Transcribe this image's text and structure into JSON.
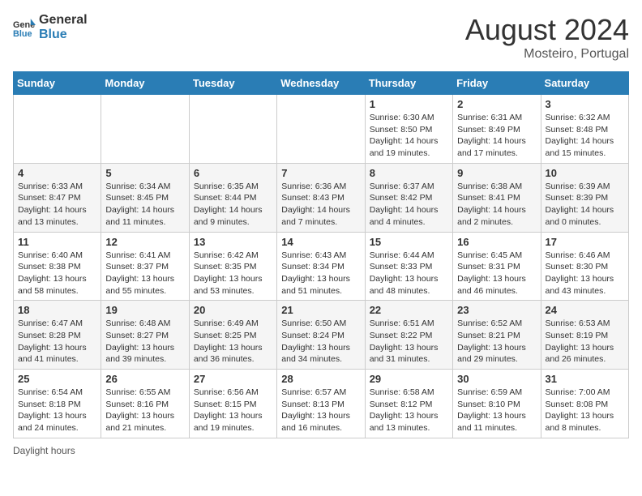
{
  "logo": {
    "line1": "General",
    "line2": "Blue"
  },
  "title": {
    "month_year": "August 2024",
    "location": "Mosteiro, Portugal"
  },
  "days_of_week": [
    "Sunday",
    "Monday",
    "Tuesday",
    "Wednesday",
    "Thursday",
    "Friday",
    "Saturday"
  ],
  "weeks": [
    [
      {
        "day": "",
        "info": ""
      },
      {
        "day": "",
        "info": ""
      },
      {
        "day": "",
        "info": ""
      },
      {
        "day": "",
        "info": ""
      },
      {
        "day": "1",
        "info": "Sunrise: 6:30 AM\nSunset: 8:50 PM\nDaylight: 14 hours\nand 19 minutes."
      },
      {
        "day": "2",
        "info": "Sunrise: 6:31 AM\nSunset: 8:49 PM\nDaylight: 14 hours\nand 17 minutes."
      },
      {
        "day": "3",
        "info": "Sunrise: 6:32 AM\nSunset: 8:48 PM\nDaylight: 14 hours\nand 15 minutes."
      }
    ],
    [
      {
        "day": "4",
        "info": "Sunrise: 6:33 AM\nSunset: 8:47 PM\nDaylight: 14 hours\nand 13 minutes."
      },
      {
        "day": "5",
        "info": "Sunrise: 6:34 AM\nSunset: 8:45 PM\nDaylight: 14 hours\nand 11 minutes."
      },
      {
        "day": "6",
        "info": "Sunrise: 6:35 AM\nSunset: 8:44 PM\nDaylight: 14 hours\nand 9 minutes."
      },
      {
        "day": "7",
        "info": "Sunrise: 6:36 AM\nSunset: 8:43 PM\nDaylight: 14 hours\nand 7 minutes."
      },
      {
        "day": "8",
        "info": "Sunrise: 6:37 AM\nSunset: 8:42 PM\nDaylight: 14 hours\nand 4 minutes."
      },
      {
        "day": "9",
        "info": "Sunrise: 6:38 AM\nSunset: 8:41 PM\nDaylight: 14 hours\nand 2 minutes."
      },
      {
        "day": "10",
        "info": "Sunrise: 6:39 AM\nSunset: 8:39 PM\nDaylight: 14 hours\nand 0 minutes."
      }
    ],
    [
      {
        "day": "11",
        "info": "Sunrise: 6:40 AM\nSunset: 8:38 PM\nDaylight: 13 hours\nand 58 minutes."
      },
      {
        "day": "12",
        "info": "Sunrise: 6:41 AM\nSunset: 8:37 PM\nDaylight: 13 hours\nand 55 minutes."
      },
      {
        "day": "13",
        "info": "Sunrise: 6:42 AM\nSunset: 8:35 PM\nDaylight: 13 hours\nand 53 minutes."
      },
      {
        "day": "14",
        "info": "Sunrise: 6:43 AM\nSunset: 8:34 PM\nDaylight: 13 hours\nand 51 minutes."
      },
      {
        "day": "15",
        "info": "Sunrise: 6:44 AM\nSunset: 8:33 PM\nDaylight: 13 hours\nand 48 minutes."
      },
      {
        "day": "16",
        "info": "Sunrise: 6:45 AM\nSunset: 8:31 PM\nDaylight: 13 hours\nand 46 minutes."
      },
      {
        "day": "17",
        "info": "Sunrise: 6:46 AM\nSunset: 8:30 PM\nDaylight: 13 hours\nand 43 minutes."
      }
    ],
    [
      {
        "day": "18",
        "info": "Sunrise: 6:47 AM\nSunset: 8:28 PM\nDaylight: 13 hours\nand 41 minutes."
      },
      {
        "day": "19",
        "info": "Sunrise: 6:48 AM\nSunset: 8:27 PM\nDaylight: 13 hours\nand 39 minutes."
      },
      {
        "day": "20",
        "info": "Sunrise: 6:49 AM\nSunset: 8:25 PM\nDaylight: 13 hours\nand 36 minutes."
      },
      {
        "day": "21",
        "info": "Sunrise: 6:50 AM\nSunset: 8:24 PM\nDaylight: 13 hours\nand 34 minutes."
      },
      {
        "day": "22",
        "info": "Sunrise: 6:51 AM\nSunset: 8:22 PM\nDaylight: 13 hours\nand 31 minutes."
      },
      {
        "day": "23",
        "info": "Sunrise: 6:52 AM\nSunset: 8:21 PM\nDaylight: 13 hours\nand 29 minutes."
      },
      {
        "day": "24",
        "info": "Sunrise: 6:53 AM\nSunset: 8:19 PM\nDaylight: 13 hours\nand 26 minutes."
      }
    ],
    [
      {
        "day": "25",
        "info": "Sunrise: 6:54 AM\nSunset: 8:18 PM\nDaylight: 13 hours\nand 24 minutes."
      },
      {
        "day": "26",
        "info": "Sunrise: 6:55 AM\nSunset: 8:16 PM\nDaylight: 13 hours\nand 21 minutes."
      },
      {
        "day": "27",
        "info": "Sunrise: 6:56 AM\nSunset: 8:15 PM\nDaylight: 13 hours\nand 19 minutes."
      },
      {
        "day": "28",
        "info": "Sunrise: 6:57 AM\nSunset: 8:13 PM\nDaylight: 13 hours\nand 16 minutes."
      },
      {
        "day": "29",
        "info": "Sunrise: 6:58 AM\nSunset: 8:12 PM\nDaylight: 13 hours\nand 13 minutes."
      },
      {
        "day": "30",
        "info": "Sunrise: 6:59 AM\nSunset: 8:10 PM\nDaylight: 13 hours\nand 11 minutes."
      },
      {
        "day": "31",
        "info": "Sunrise: 7:00 AM\nSunset: 8:08 PM\nDaylight: 13 hours\nand 8 minutes."
      }
    ]
  ],
  "footer": {
    "daylight_label": "Daylight hours"
  }
}
